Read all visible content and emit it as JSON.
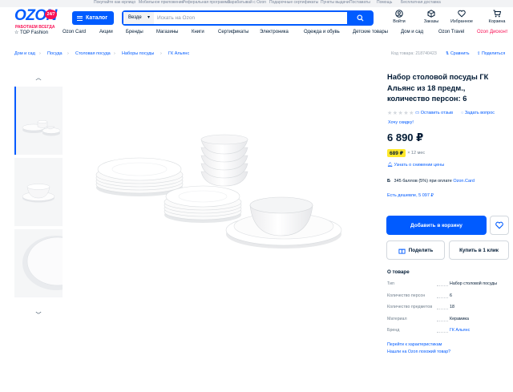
{
  "top_links": [
    "Покупайте как юрлицо",
    "Мобильное приложение",
    "Реферальная программа",
    "Зарабатывай с Ozon",
    "Подарочные сертификаты",
    "Пункты выдачи",
    "Постаматы",
    "Помощь",
    "Бесплатная доставка"
  ],
  "logo": {
    "word": "OZON",
    "badge": "24/7",
    "subtitle": "РАБОТАЕМ ВСЕГДА"
  },
  "catalog_label": "Каталог",
  "search": {
    "scope": "Везде",
    "placeholder": "Искать на Ozon"
  },
  "header_actions": [
    "Войти",
    "Заказы",
    "Избранное",
    "Корзина"
  ],
  "nav": [
    "TOP Fashion",
    "Ozon Card",
    "Акции",
    "Бренды",
    "Магазины",
    "Книги",
    "Сертификаты",
    "Электроника",
    "Одежда и обувь",
    "Детские товары",
    "Дом и сад",
    "Ozon Travel",
    "Ozon Дисконт"
  ],
  "breadcrumbs": [
    "Дом и сад",
    "Посуда",
    "Столовая посуда",
    "Наборы посуды",
    "ГК Альянс"
  ],
  "product_code": "Код товара: 218740423",
  "compare_label": "Сравнить",
  "share_top_label": "Поделиться",
  "product": {
    "title": "Набор столовой посуды ГК Альянс из 18 предм., количество персон: 6",
    "reviews_link": "Оставить отзыв",
    "question_link": "Задать вопрос",
    "want_discount": "Хочу скидку!",
    "price": "6 890 ₽",
    "installment_price": "689 ₽",
    "installment_term": "× 12 мес",
    "notify_label": "Узнать о снижении цены",
    "bonus": {
      "amount": "345 баллов (5%)",
      "text": "при оплате",
      "card": "Ozon.Card"
    },
    "cheaper": "Есть дешевле, 5 097 ₽",
    "add_to_cart": "Добавить в корзину",
    "share_button": "Поделить",
    "one_click": "Купить в 1 клик"
  },
  "about": {
    "heading": "О товаре",
    "specs": [
      {
        "k": "Тип",
        "v": "Набор столовой посуды"
      },
      {
        "k": "Количество персон",
        "v": "6"
      },
      {
        "k": "Количество предметов",
        "v": "18"
      },
      {
        "k": "Материал",
        "v": "Керамика"
      },
      {
        "k": "Бренд",
        "v": "ГК Альянс"
      }
    ],
    "to_specs": "Перейти к характеристикам",
    "found_cheaper": "Нашли на Ozon похожий товар?"
  },
  "colors": {
    "brand_blue": "#005bff",
    "brand_pink": "#f91155",
    "installment_yellow": "#ffe82b"
  }
}
